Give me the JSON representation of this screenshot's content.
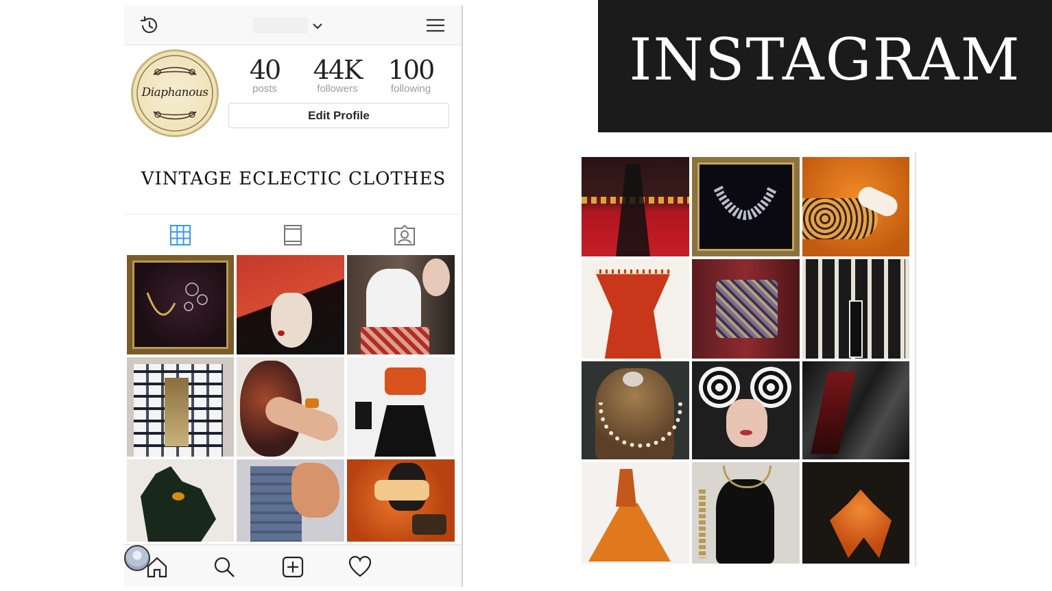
{
  "header": {
    "history_icon": "history-icon",
    "dropdown_icon": "chevron-down-icon",
    "menu_icon": "hamburger-menu-icon"
  },
  "profile": {
    "avatar_text": "Diaphanous",
    "stats": [
      {
        "value": "40",
        "label": "posts"
      },
      {
        "value": "44K",
        "label": "followers"
      },
      {
        "value": "100",
        "label": "following"
      }
    ],
    "edit_profile_label": "Edit Profile",
    "bio": "VINTAGE ECLECTIC CLOTHES"
  },
  "tabs": {
    "grid_icon": "grid-view-icon",
    "list_icon": "list-view-icon",
    "tagged_icon": "tagged-photos-icon",
    "active_color": "#3897f0"
  },
  "phone_photos": [
    "framed-necklace-photo",
    "red-hat-illustration-photo",
    "white-corset-photo",
    "geometric-jacket-photo",
    "vase-and-hand-photo",
    "orange-top-outfit-photo",
    "green-gloves-photo",
    "ruffled-blue-dress-photo",
    "orange-cat-painting-photo"
  ],
  "bottom_nav": {
    "home_icon": "home-icon",
    "search_icon": "search-icon",
    "add_icon": "add-post-icon",
    "activity_icon": "heart-icon",
    "profile_icon": "profile-avatar-icon"
  },
  "brand": {
    "title": "INSTAGRAM",
    "background": "#1c1b1b"
  },
  "feature_photos": [
    "red-skirt-photo",
    "framed-collar-photo",
    "leopard-glove-illustration-photo",
    "red-corset-illustration-photo",
    "brocade-bodice-photo",
    "art-deco-illustration-photo",
    "jeweled-mannequin-photo",
    "spiral-glasses-photo",
    "leather-drape-photo",
    "orange-gown-sketch-photo",
    "black-bustier-photo",
    "orange-feathers-photo"
  ]
}
